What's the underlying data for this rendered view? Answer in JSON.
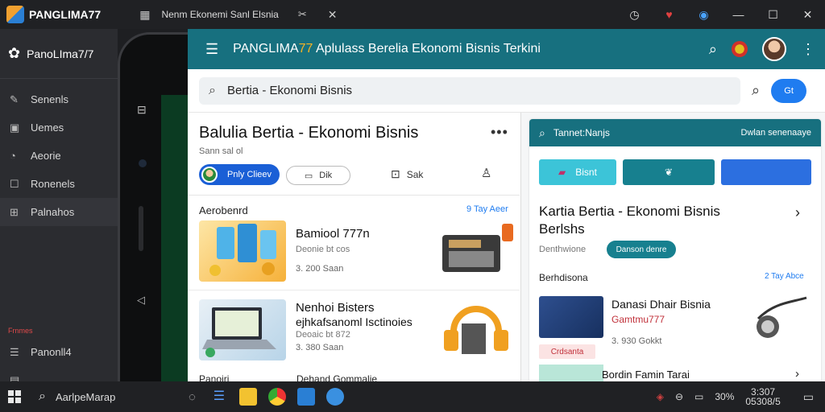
{
  "titlebar": {
    "brand": "PANGLIMA77",
    "grid_icon": "grid-icon",
    "tab_title": "Nenm Ekonemi Sanl Elsnia",
    "pin_icon": "pin-icon",
    "close_tab_icon": "close-icon",
    "controls": [
      "history-icon",
      "heart-icon",
      "shield-icon",
      "minimize-icon",
      "maximize-icon",
      "close-icon"
    ]
  },
  "sidebar": {
    "title": "PanoLIma7/7",
    "items": [
      {
        "icon": "edit-icon",
        "label": "Senenls"
      },
      {
        "icon": "image-icon",
        "label": "Uemes"
      },
      {
        "icon": "clock-icon",
        "label": "Aeorie"
      },
      {
        "icon": "square-icon",
        "label": "Ronenels"
      },
      {
        "icon": "table-icon",
        "label": "Palnahos"
      }
    ],
    "section_label": "Frnmes",
    "bottom_items": [
      {
        "icon": "panel-icon",
        "label": "Panonll4"
      }
    ]
  },
  "app": {
    "title_prefix": "PANGLIMA",
    "title_seven": "77",
    "title_rest": " Aplulass Berelia Ekonomi Bisnis Terkini",
    "search": {
      "value": "Bertia - Ekonomi Bisnis",
      "button_label": "Gt"
    },
    "article": {
      "title": "Balulia Bertia - Ekonomi Bisnis",
      "subtitle": "Sann sal ol",
      "profile_btn": "Pnly Clieev",
      "tv_btn": "Dik",
      "save_btn": "Sak"
    },
    "section": {
      "label": "Aerobenrd",
      "link": "9 Tay Aeer"
    },
    "items": [
      {
        "title": "Bamiool 777n",
        "title2": "",
        "sub": "Deonie bt cos",
        "meta": "3. 200 Saan"
      },
      {
        "title": "Nenhoi Bisters",
        "title2": "ejhkafsanoml Isctinoies",
        "sub": "Deoaic bt 872",
        "meta": "3. 380 Saan"
      }
    ],
    "bottom_peek": [
      "Panoiri",
      "Dehand Gommalie"
    ]
  },
  "card": {
    "head_label": "Tannet:Nanjs",
    "head_right": "Dwlan senenaaye",
    "tile1_label": "Bisnt",
    "card_title_1": "Kartia Bertia - Ekonomi Bisnis",
    "card_title_2": "Berlshs",
    "meta": "Denthwione",
    "pill": "Danson denre",
    "section": {
      "label": "Berhdisona",
      "link": "2 Tay Abce"
    },
    "item": {
      "title": "Danasi Dhair Bisnia",
      "sub": "Gamtmu777",
      "badge": "Crdsanta",
      "meta": "3. 930 Gokkt"
    },
    "peek": "Bordin Famin Tarai"
  },
  "taskbar": {
    "search_label": "AarlpeMarap",
    "tray_percent": "30%",
    "clock_time": "3:307",
    "clock_date": "05308/5"
  }
}
